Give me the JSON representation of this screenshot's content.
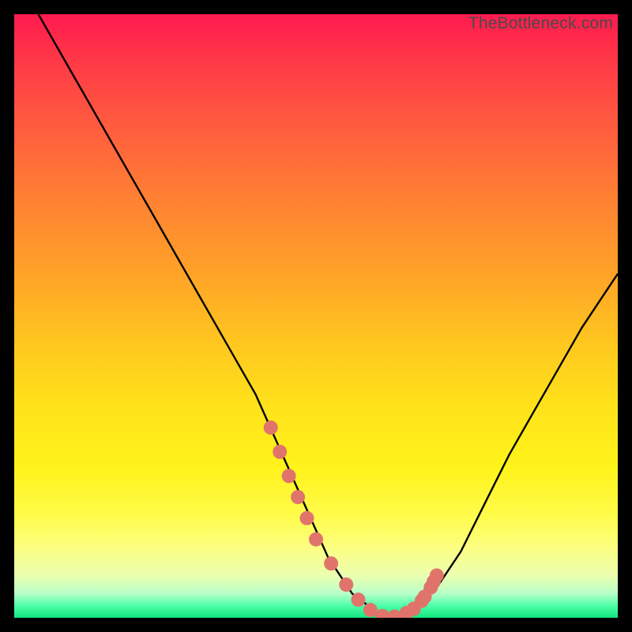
{
  "watermark": "TheBottleneck.com",
  "colors": {
    "curve_stroke": "#000000",
    "marker_fill": "#e0746b",
    "marker_stroke": "#d85f57"
  },
  "chart_data": {
    "type": "line",
    "title": "",
    "xlabel": "",
    "ylabel": "",
    "xlim": [
      0,
      100
    ],
    "ylim": [
      0,
      100
    ],
    "grid": false,
    "legend": false,
    "series": [
      {
        "name": "curve",
        "x": [
          4,
          8,
          12,
          16,
          20,
          24,
          28,
          32,
          36,
          40,
          44,
          48,
          52,
          56,
          60,
          62,
          66,
          70,
          74,
          78,
          82,
          86,
          90,
          94,
          98,
          100
        ],
        "y": [
          100,
          93,
          86,
          79,
          72,
          65,
          58,
          51,
          44,
          37,
          28,
          19,
          10,
          4,
          1,
          0,
          1,
          5,
          11,
          19,
          27,
          34,
          41,
          48,
          54,
          57
        ]
      }
    ],
    "markers": {
      "name": "highlighted-points",
      "x": [
        42.5,
        44.0,
        45.5,
        47.0,
        48.5,
        50.0,
        52.5,
        55.0,
        57.0,
        59.0,
        61.0,
        63.0,
        65.0,
        66.2,
        67.5,
        68.0,
        69.0,
        69.5,
        70.0
      ],
      "y": [
        31.5,
        27.5,
        23.5,
        20.0,
        16.5,
        13.0,
        9.0,
        5.5,
        3.0,
        1.3,
        0.3,
        0.2,
        0.8,
        1.5,
        2.8,
        3.5,
        5.0,
        6.0,
        7.0
      ]
    }
  }
}
